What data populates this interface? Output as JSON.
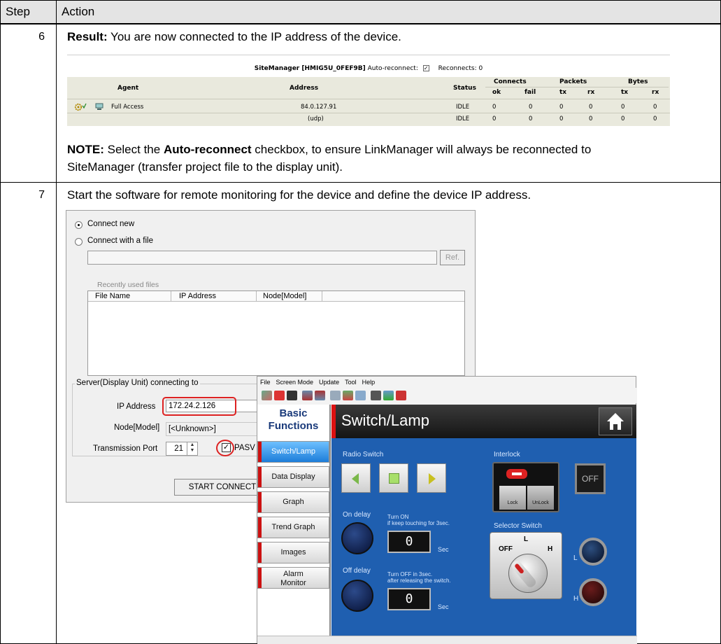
{
  "table": {
    "col_step": "Step",
    "col_action": "Action"
  },
  "row6": {
    "step": "6",
    "result_label": "Result:",
    "result_text": " You are now connected to the IP address of the device.",
    "note_label": "NOTE:",
    "note_text_1": " Select the ",
    "note_bold": "Auto-reconnect",
    "note_text_2": " checkbox, to ensure LinkManager will always be reconnected to",
    "note_text_3": "SiteManager (transfer project file to the display unit)."
  },
  "sitemanager": {
    "title": "SiteManager [HMIG5U_0FEF9B]",
    "auto_reconnect_label": "Auto-reconnect:",
    "reconnects_label": "Reconnects: 0",
    "headers": {
      "agent": "Agent",
      "address": "Address",
      "status": "Status",
      "connects": "Connects",
      "packets": "Packets",
      "bytes": "Bytes",
      "ok": "ok",
      "fail": "fail",
      "tx1": "tx",
      "rx1": "rx",
      "tx2": "tx",
      "rx2": "rx"
    },
    "rows": [
      {
        "agent": "Full Access",
        "address": "84.0.127.91",
        "status": "IDLE",
        "ok": "0",
        "fail": "0",
        "ptx": "0",
        "prx": "0",
        "btx": "0",
        "brx": "0"
      },
      {
        "agent": "",
        "address": "(udp)",
        "status": "IDLE",
        "ok": "0",
        "fail": "0",
        "ptx": "0",
        "prx": "0",
        "btx": "0",
        "brx": "0"
      }
    ]
  },
  "row7": {
    "step": "7",
    "text": "Start the software for remote monitoring for the device and define the device IP address."
  },
  "dialog": {
    "connect_new": "Connect new",
    "connect_file": "Connect with a file",
    "ref_button": "Ref.",
    "recent_files": "Recently used files",
    "col_file_name": "File Name",
    "col_ip": "IP Address",
    "col_node": "Node[Model]",
    "server_group": "Server(Display Unit) connecting to",
    "ip_label": "IP Address",
    "ip_value": "172.24.2.126",
    "node_label": "Node[Model]",
    "node_value": "[<Unknown>]",
    "port_label": "Transmission Port",
    "port_value": "21",
    "pasv_label": "PASV",
    "start_button": "START CONNECTIO"
  },
  "hmi": {
    "menu": [
      "File",
      "Screen Mode",
      "Update",
      "Tool",
      "Help"
    ],
    "sidebar_title_1": "Basic",
    "sidebar_title_2": "Functions",
    "title": "Switch/Lamp",
    "nav": [
      "Switch/Lamp",
      "Data Display",
      "Graph",
      "Trend Graph",
      "Images",
      "Alarm",
      "Monitor"
    ],
    "radio_switch": "Radio Switch",
    "interlock": "Interlock",
    "lock": "Lock",
    "unlock": "UnLock",
    "off_button": "OFF",
    "on_delay": "On delay",
    "turn_on": "Turn ON",
    "turn_on_sub": "if keep touching for 3sec.",
    "sec1": "Sec",
    "lcd1": "0",
    "selector_switch": "Selector Switch",
    "sel_off": "OFF",
    "sel_l": "L",
    "sel_h": "H",
    "lamp_l": "L",
    "lamp_h": "H",
    "off_delay": "Off delay",
    "turn_off": "Turn OFF in 3sec.",
    "turn_off_sub": "after releasing the switch.",
    "sec2": "Sec",
    "lcd2": "0"
  }
}
